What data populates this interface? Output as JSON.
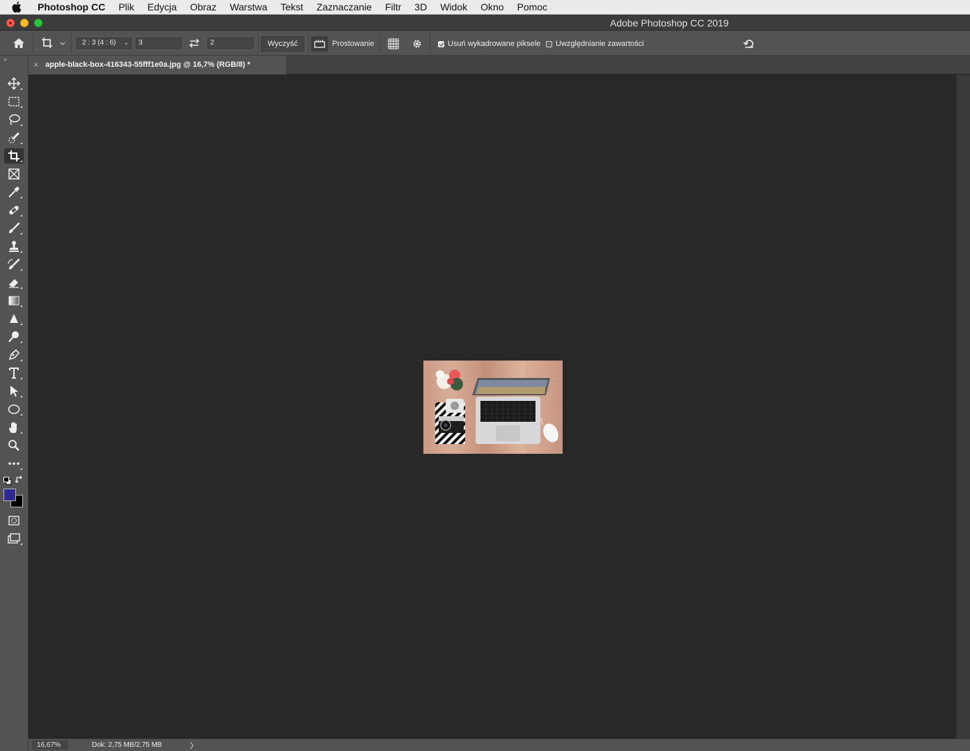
{
  "menubar": {
    "app_name": "Photoshop CC",
    "items": [
      "Plik",
      "Edycja",
      "Obraz",
      "Warstwa",
      "Tekst",
      "Zaznaczanie",
      "Filtr",
      "3D",
      "Widok",
      "Okno",
      "Pomoc"
    ]
  },
  "window": {
    "title": "Adobe Photoshop CC 2019"
  },
  "options_bar": {
    "ratio_preset": "2 : 3 (4 : 6)",
    "width_value": "3",
    "height_value": "2",
    "clear_button": "Wyczyść",
    "straighten_label": "Prostowanie",
    "delete_cropped_label": "Usuń wykadrowane piksele",
    "delete_cropped_checked": true,
    "content_aware_label": "Uwzględnianie zawartości",
    "content_aware_checked": false
  },
  "document": {
    "tab_title": "apple-black-box-416343-55fff1e0a.jpg @ 16,7% (RGB/8) *"
  },
  "toolbar": {
    "collapse_glyph": "››",
    "tools": [
      "move-tool",
      "marquee-tool",
      "lasso-tool",
      "quick-selection-tool",
      "crop-tool",
      "frame-tool",
      "eyedropper-tool",
      "healing-brush-tool",
      "brush-tool",
      "clone-stamp-tool",
      "history-brush-tool",
      "eraser-tool",
      "gradient-tool",
      "blur-tool",
      "dodge-tool",
      "pen-tool",
      "type-tool",
      "path-selection-tool",
      "ellipse-tool",
      "hand-tool",
      "zoom-tool",
      "edit-toolbar"
    ],
    "active_tool": "crop-tool",
    "foreground_color": "#2e2a8f",
    "background_color": "#000000"
  },
  "status_bar": {
    "zoom": "16,67%",
    "doc_info": "Dok: 2,75 MB/2,75 MB",
    "arrow": "〉"
  }
}
